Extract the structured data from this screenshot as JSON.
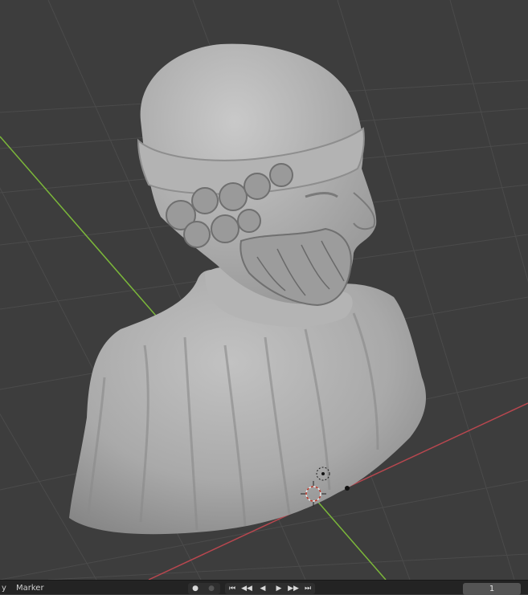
{
  "timeline": {
    "view_label_fragment": "y",
    "marker_label": "Marker",
    "current_frame": "1"
  },
  "viewport": {
    "object": "sculpted-bust-mesh",
    "background_color": "#3d3d3d",
    "grid_color": "#4c4c4c",
    "x_axis_color": "#b8474f",
    "y_axis_color": "#7bb73a",
    "mesh_color": "#a8a8a8"
  },
  "icons": {
    "keyframe_dot": "dot-icon",
    "jump_start": "jump-to-start-icon",
    "prev_keyframe": "previous-keyframe-icon",
    "play_reverse": "play-reverse-icon",
    "play": "play-icon",
    "next_keyframe": "next-keyframe-icon",
    "jump_end": "jump-to-end-icon",
    "cursor": "3d-cursor-icon"
  }
}
